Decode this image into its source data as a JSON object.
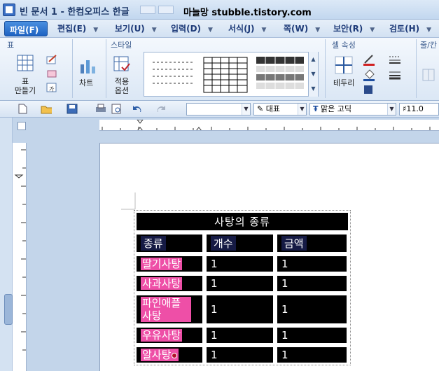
{
  "titlebar": {
    "doc_title": "빈 문서 1 - 한컴오피스 한글",
    "blog": "마늘망 stubble.tistory.com"
  },
  "menu": {
    "file": "파일(F)",
    "items": [
      "편집(E)",
      "보기(U)",
      "입력(D)",
      "서식(J)",
      "쪽(W)",
      "보안(R)",
      "검토(H)"
    ]
  },
  "ribbon": {
    "group_table": "표",
    "make_table": "표\n만들기",
    "chart": "차트",
    "group_style": "스타일",
    "apply_options": "적용\n옵션",
    "group_cell_props": "셀 속성",
    "border": "테두리",
    "group_rowcol": "줄/칸"
  },
  "toolbar": {
    "style_combo": "",
    "lang_combo": "대표",
    "font_combo": "맑은 고딕",
    "size_combo": "11.0"
  },
  "table": {
    "title": "사탕의 종류",
    "headers": [
      "종류",
      "개수",
      "금액"
    ],
    "rows": [
      {
        "name": "딸기사탕",
        "count": "1",
        "price": "1"
      },
      {
        "name": "사과사탕",
        "count": "1",
        "price": "1"
      },
      {
        "name": "파인애플사탕",
        "count": "1",
        "price": "1"
      },
      {
        "name": "우유사탕",
        "count": "1",
        "price": "1"
      },
      {
        "name": "알사탕",
        "count": "1",
        "price": "1"
      }
    ]
  },
  "colors": {
    "cell_bg": "#000000",
    "highlight": "#ee4fa7",
    "header_bg": "#151a44",
    "accent": "#1e63c2"
  }
}
